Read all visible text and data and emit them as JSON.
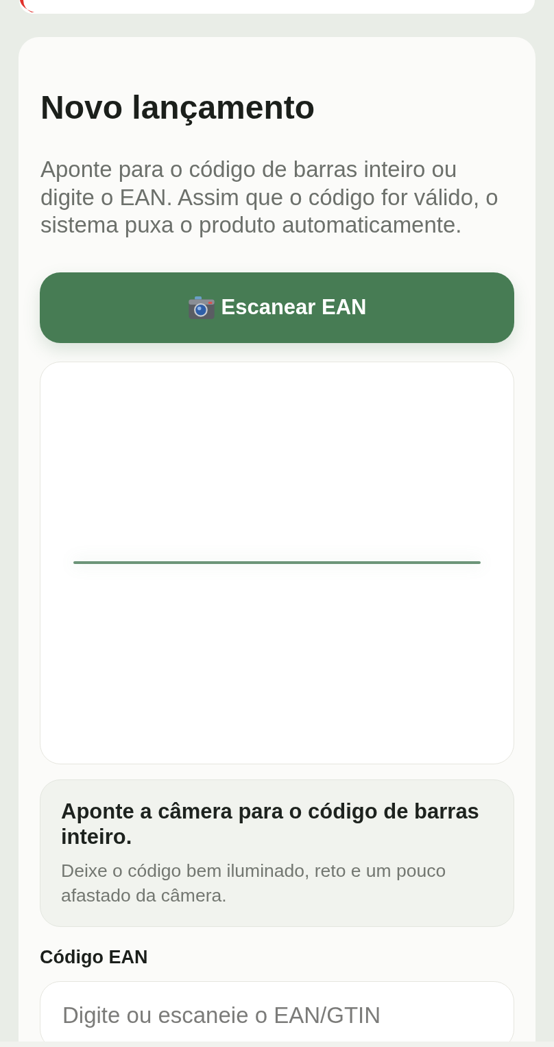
{
  "card": {
    "title": "Novo lançamento",
    "description": "Aponte para o código de barras inteiro ou digite o EAN. Assim que o código for válido, o sistema puxa o produto automaticamente.",
    "scan_button": {
      "label": "Escanear EAN"
    },
    "hint": {
      "title": "Aponte a câmera para o código de barras inteiro.",
      "text": "Deixe o código bem iluminado, reto e um pouco afastado da câmera."
    },
    "ean_field": {
      "label": "Código EAN",
      "placeholder": "Digite ou escaneie o EAN/GTIN"
    }
  }
}
